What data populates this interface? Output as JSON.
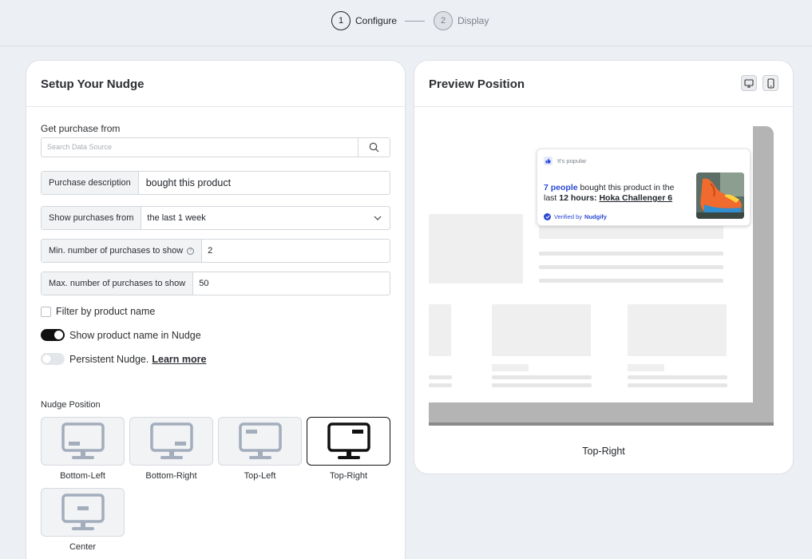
{
  "stepper": {
    "steps": [
      {
        "number": "1",
        "label": "Configure"
      },
      {
        "number": "2",
        "label": "Display"
      }
    ]
  },
  "setup": {
    "title": "Setup Your Nudge",
    "source_label": "Get purchase from",
    "search_placeholder": "Search Data Source",
    "purchase_description": {
      "label": "Purchase description",
      "value": "bought this product"
    },
    "show_purchases_from": {
      "label": "Show purchases from",
      "value": "the last 1 week"
    },
    "min_purchases": {
      "label": "Min. number of purchases to show",
      "value": "2"
    },
    "max_purchases": {
      "label": "Max. number of purchases to show",
      "value": "50"
    },
    "filter_by_product": {
      "label": "Filter by product name",
      "checked": false
    },
    "show_product_name": {
      "label": "Show product name in Nudge",
      "on": true
    },
    "persistent": {
      "label": "Persistent Nudge.",
      "link": "Learn more",
      "on": false
    },
    "position_label": "Nudge Position",
    "positions": [
      {
        "label": "Bottom-Left"
      },
      {
        "label": "Bottom-Right"
      },
      {
        "label": "Top-Left"
      },
      {
        "label": "Top-Right",
        "selected": true
      },
      {
        "label": "Center"
      }
    ]
  },
  "preview": {
    "title": "Preview Position",
    "nudge": {
      "badge": "It's popular",
      "count": "7 people",
      "text_1": "bought this product in the last",
      "time": "12 hours:",
      "product": "Hoka Challenger 6",
      "verified_by": "Verified by",
      "brand": "Nudgify"
    },
    "position_name": "Top-Right"
  },
  "icons": {
    "search": "search-icon",
    "chevron": "chevron-down-icon",
    "desktop": "desktop-icon",
    "mobile": "mobile-icon",
    "thumbs_up": "thumbs-up-icon",
    "verified": "verified-check-icon"
  },
  "colors": {
    "accent": "#2a48d4",
    "selected_border": "#111111",
    "monitor_icon": "#a3adbb"
  }
}
